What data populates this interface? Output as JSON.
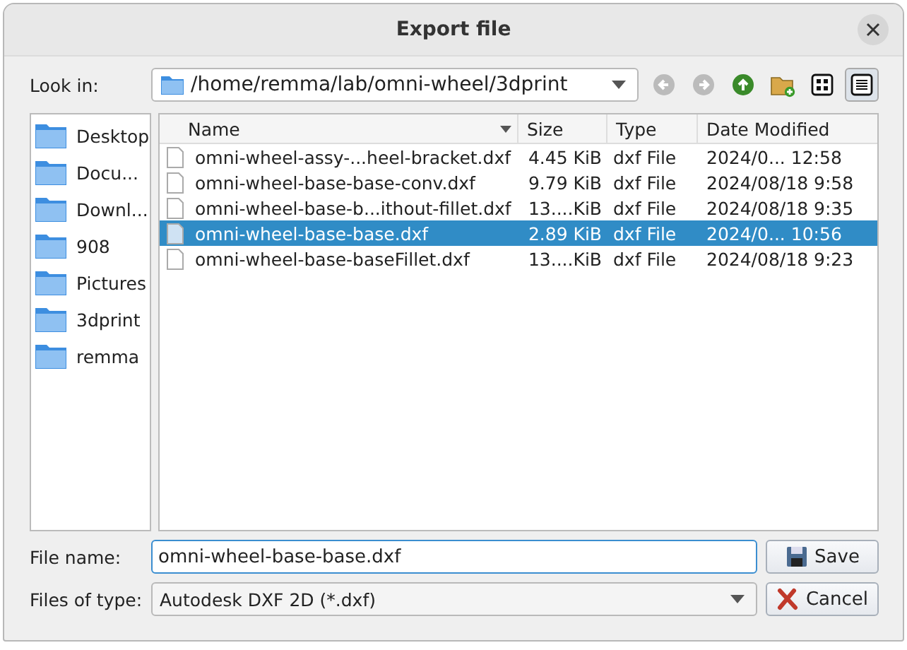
{
  "window": {
    "title": "Export file"
  },
  "look_in": {
    "label": "Look in:",
    "path": "/home/remma/lab/omni-wheel/3dprint"
  },
  "toolbar": [
    {
      "kind": "back",
      "disabled": true
    },
    {
      "kind": "forward",
      "disabled": true
    },
    {
      "kind": "up",
      "disabled": false
    },
    {
      "kind": "new-folder"
    },
    {
      "kind": "icon-view",
      "selected": false
    },
    {
      "kind": "detail-view",
      "selected": true
    }
  ],
  "sidebar": {
    "items": [
      {
        "label": "Desktop"
      },
      {
        "label": "Docu..."
      },
      {
        "label": "Downl..."
      },
      {
        "label": "908"
      },
      {
        "label": "Pictures"
      },
      {
        "label": "3dprint"
      },
      {
        "label": "remma"
      }
    ]
  },
  "table": {
    "columns": [
      "Name",
      "Size",
      "Type",
      "Date Modified"
    ],
    "rows": [
      {
        "name": "omni-wheel-assy-...heel-bracket.dxf",
        "size": "4.45 KiB",
        "type": "dxf File",
        "date": "2024/0... 12:58",
        "selected": false
      },
      {
        "name": "omni-wheel-base-base-conv.dxf",
        "size": "9.79 KiB",
        "type": "dxf File",
        "date": "2024/08/18 9:58",
        "selected": false
      },
      {
        "name": "omni-wheel-base-b...ithout-fillet.dxf",
        "size": "13....KiB",
        "type": "dxf File",
        "date": "2024/08/18 9:35",
        "selected": false
      },
      {
        "name": "omni-wheel-base-base.dxf",
        "size": "2.89 KiB",
        "type": "dxf File",
        "date": "2024/0... 10:56",
        "selected": true
      },
      {
        "name": "omni-wheel-base-baseFillet.dxf",
        "size": "13....KiB",
        "type": "dxf File",
        "date": "2024/08/18 9:23",
        "selected": false
      }
    ]
  },
  "file_name": {
    "label": "File name:",
    "value": "omni-wheel-base-base.dxf"
  },
  "file_type": {
    "label": "Files of type:",
    "value": "Autodesk DXF 2D (*.dxf)"
  },
  "buttons": [
    {
      "kind": "save",
      "label": "Save"
    },
    {
      "kind": "cancel",
      "label": "Cancel"
    }
  ]
}
